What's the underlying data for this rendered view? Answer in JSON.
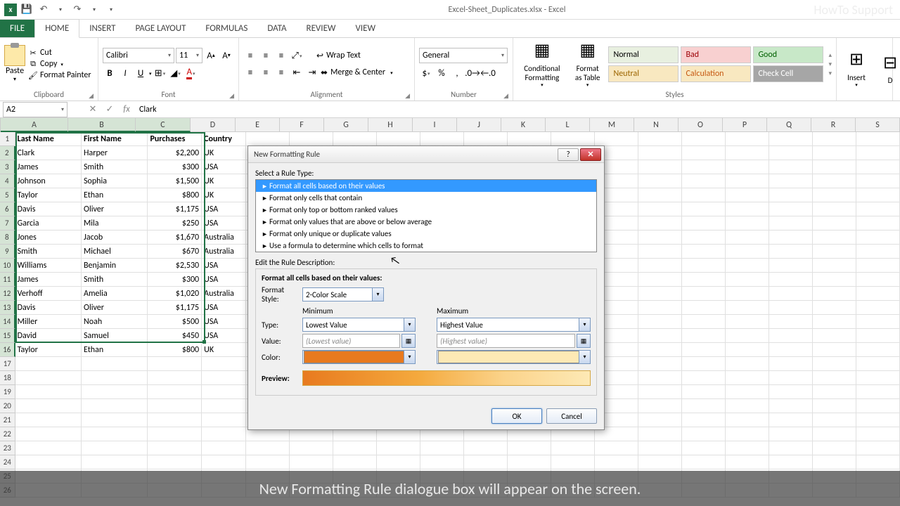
{
  "app": {
    "title": "Excel-Sheet_Duplicates.xlsx - Excel",
    "watermark": "HowTo Support"
  },
  "qat": {
    "save": "💾",
    "undo": "↶",
    "redo": "↷"
  },
  "tabs": {
    "file": "FILE",
    "home": "HOME",
    "insert": "INSERT",
    "page_layout": "PAGE LAYOUT",
    "formulas": "FORMULAS",
    "data": "DATA",
    "review": "REVIEW",
    "view": "VIEW"
  },
  "ribbon": {
    "clipboard": {
      "label": "Clipboard",
      "paste": "Paste",
      "cut": "Cut",
      "copy": "Copy",
      "painter": "Format Painter"
    },
    "font": {
      "label": "Font",
      "name": "Calibri",
      "size": "11"
    },
    "alignment": {
      "label": "Alignment",
      "wrap": "Wrap Text",
      "merge": "Merge & Center"
    },
    "number": {
      "label": "Number",
      "format": "General"
    },
    "cond_fmt": "Conditional Formatting",
    "fmt_table": "Format as Table",
    "styles": {
      "label": "Styles",
      "normal": "Normal",
      "bad": "Bad",
      "good": "Good",
      "neutral": "Neutral",
      "calc": "Calculation",
      "check": "Check Cell"
    },
    "insert": "Insert",
    "delete": "D"
  },
  "namebox": "A2",
  "formula": "Clark",
  "columns": [
    "A",
    "B",
    "C",
    "D",
    "E",
    "F",
    "G",
    "H",
    "I",
    "J",
    "K",
    "L",
    "M",
    "N",
    "O",
    "P",
    "Q",
    "R",
    "S"
  ],
  "sheet": {
    "headers": [
      "Last Name",
      "First Name",
      "Purchases",
      "Country"
    ],
    "rows": [
      [
        "Clark",
        "Harper",
        "$2,200",
        "UK"
      ],
      [
        "James",
        "Smith",
        "$300",
        "USA"
      ],
      [
        "Johnson",
        "Sophia",
        "$1,500",
        "UK"
      ],
      [
        "Taylor",
        "Ethan",
        "$800",
        "UK"
      ],
      [
        "Davis",
        "Oliver",
        "$1,175",
        "USA"
      ],
      [
        "Garcia",
        "Mila",
        "$250",
        "USA"
      ],
      [
        "Jones",
        "Jacob",
        "$1,670",
        "Australia"
      ],
      [
        "Smith",
        "Michael",
        "$670",
        "Australia"
      ],
      [
        "Williams",
        "Benjamin",
        "$2,530",
        "USA"
      ],
      [
        "James",
        "Smith",
        "$300",
        "USA"
      ],
      [
        "Verhoff",
        "Amelia",
        "$1,020",
        "Australia"
      ],
      [
        "Davis",
        "Oliver",
        "$1,175",
        "USA"
      ],
      [
        "Miller",
        "Noah",
        "$500",
        "USA"
      ],
      [
        "David",
        "Samuel",
        "$450",
        "USA"
      ],
      [
        "Taylor",
        "Ethan",
        "$800",
        "UK"
      ]
    ]
  },
  "dialog": {
    "title": "New Formatting Rule",
    "select_label": "Select a Rule Type:",
    "rules": [
      "Format all cells based on their values",
      "Format only cells that contain",
      "Format only top or bottom ranked values",
      "Format only values that are above or below average",
      "Format only unique or duplicate values",
      "Use a formula to determine which cells to format"
    ],
    "edit_label": "Edit the Rule Description:",
    "sub_header": "Format all cells based on their values:",
    "format_style_lbl": "Format Style:",
    "format_style_val": "2-Color Scale",
    "min_lbl": "Minimum",
    "max_lbl": "Maximum",
    "type_lbl": "Type:",
    "type_min": "Lowest Value",
    "type_max": "Highest Value",
    "value_lbl": "Value:",
    "value_min": "(Lowest value)",
    "value_max": "(Highest value)",
    "color_lbl": "Color:",
    "color_min": "#e87a1f",
    "color_max": "#fde9b5",
    "preview_lbl": "Preview:",
    "ok": "OK",
    "cancel": "Cancel"
  },
  "caption": "New Formatting Rule dialogue box will appear on the screen."
}
